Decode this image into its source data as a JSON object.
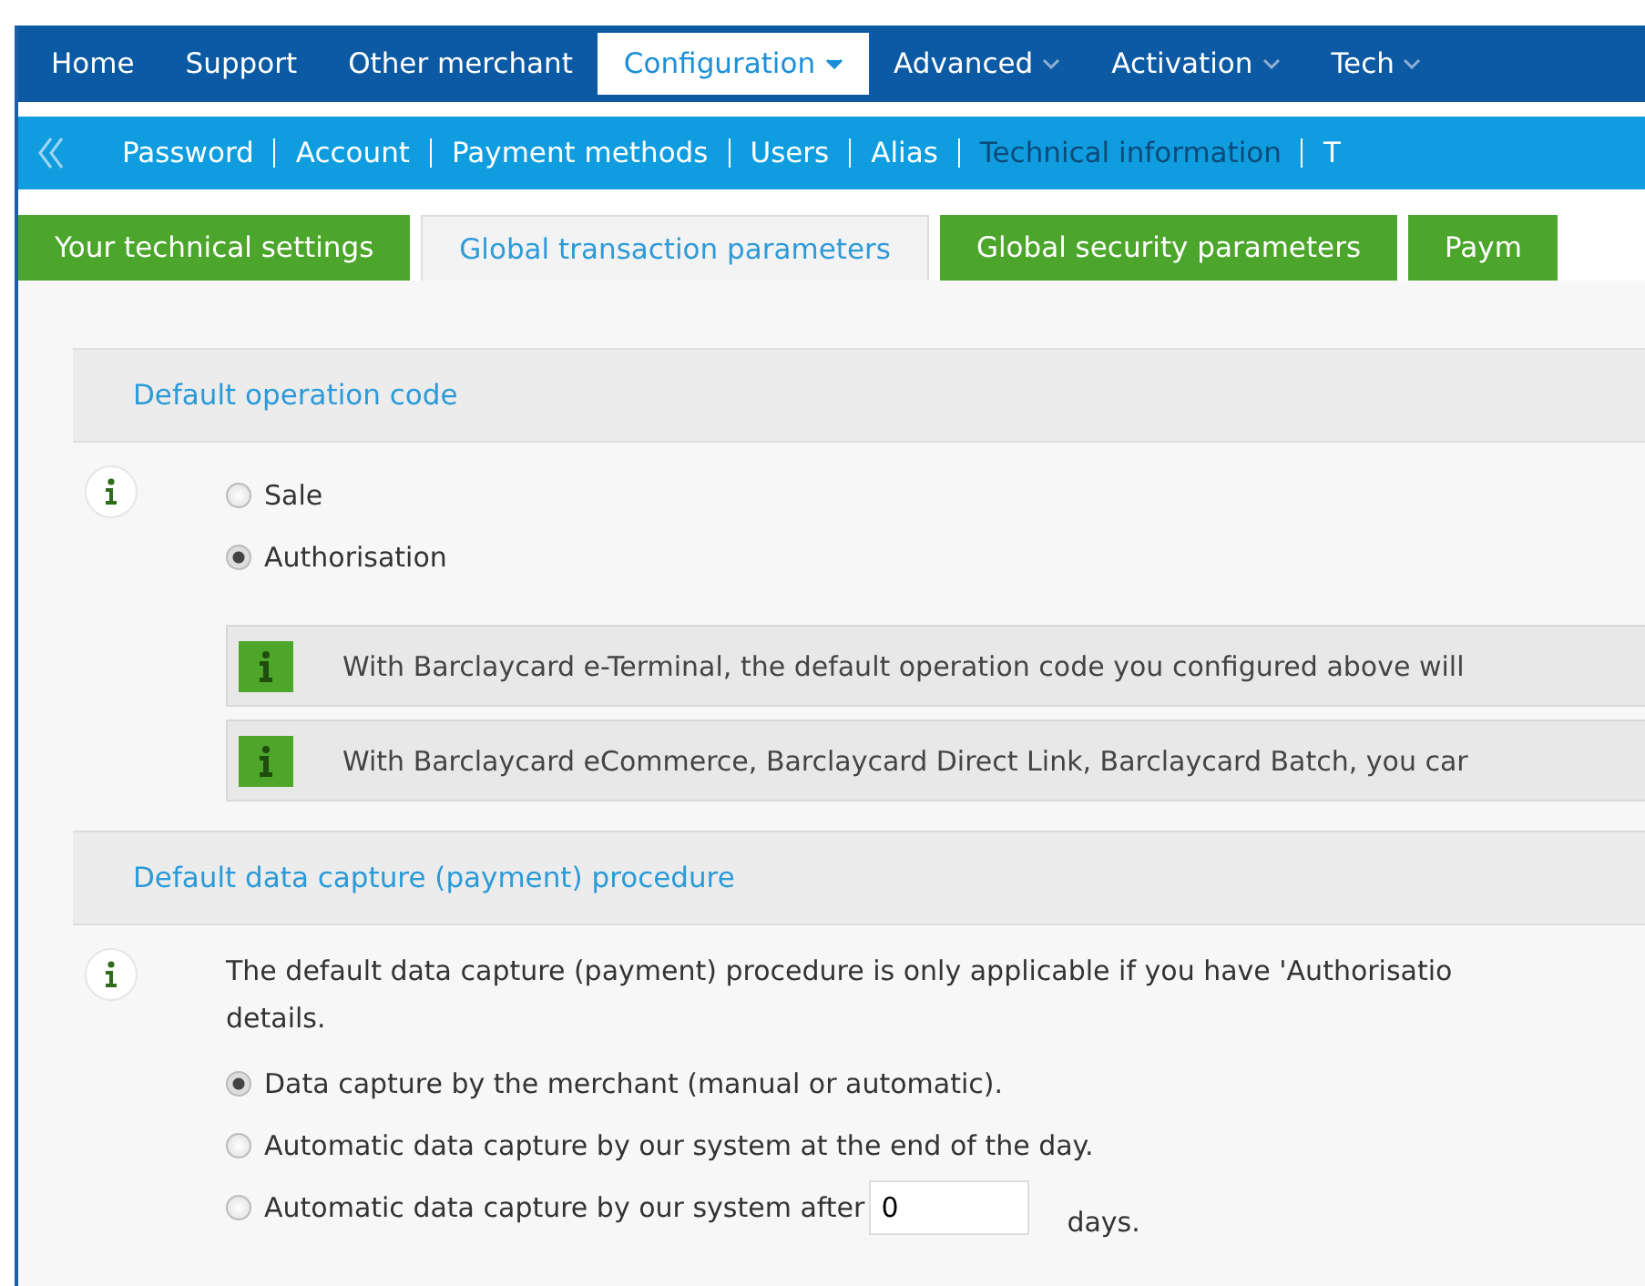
{
  "top_nav": [
    {
      "label": "Home",
      "selected": false,
      "dropdown": false
    },
    {
      "label": "Support",
      "selected": false,
      "dropdown": false
    },
    {
      "label": "Other merchant",
      "selected": false,
      "dropdown": false
    },
    {
      "label": "Configuration",
      "selected": true,
      "dropdown": true
    },
    {
      "label": "Advanced",
      "selected": false,
      "dropdown": true
    },
    {
      "label": "Activation",
      "selected": false,
      "dropdown": true
    },
    {
      "label": "Tech",
      "selected": false,
      "dropdown": true
    }
  ],
  "sub_nav": [
    {
      "label": "Password",
      "selected": false
    },
    {
      "label": "Account",
      "selected": false
    },
    {
      "label": "Payment methods",
      "selected": false
    },
    {
      "label": "Users",
      "selected": false
    },
    {
      "label": "Alias",
      "selected": false
    },
    {
      "label": "Technical information",
      "selected": true
    },
    {
      "label": "T",
      "selected": false
    }
  ],
  "tabs": [
    {
      "label": "Your technical settings",
      "selected": false
    },
    {
      "label": "Global transaction parameters",
      "selected": true
    },
    {
      "label": "Global security parameters",
      "selected": false
    },
    {
      "label": "Paym",
      "selected": false
    }
  ],
  "sections": [
    {
      "title": "Default operation code",
      "options": [
        {
          "label": "Sale",
          "selected": false
        },
        {
          "label": "Authorisation",
          "selected": true
        }
      ],
      "notes": [
        "With Barclaycard e-Terminal, the default operation code you configured above will",
        "With Barclaycard eCommerce, Barclaycard Direct Link, Barclaycard Batch, you car"
      ]
    },
    {
      "title": "Default data capture (payment) procedure",
      "intro": "The default data capture (payment) procedure is only applicable if you have 'Authorisatio details.",
      "options": [
        {
          "label": "Data capture by the merchant (manual or automatic).",
          "selected": true
        },
        {
          "label": "Automatic data capture by our system at the end of the day.",
          "selected": false
        },
        {
          "label": "Automatic data capture by our system after",
          "selected": false,
          "field": "0",
          "suffix": "days."
        }
      ]
    }
  ]
}
